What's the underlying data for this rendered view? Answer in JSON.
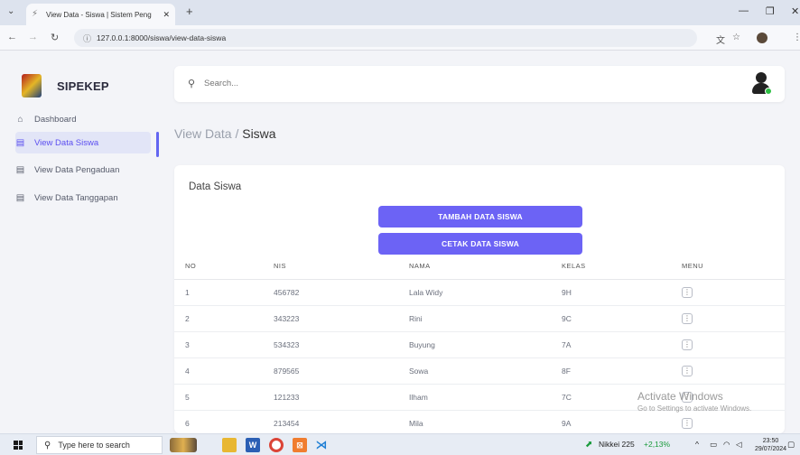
{
  "browser": {
    "tab_title": "View Data - Siswa | Sistem Peng",
    "url": "127.0.0.1:8000/siswa/view-data-siswa"
  },
  "app": {
    "brand": "SIPEKEP",
    "search_placeholder": "Search...",
    "sidebar": [
      {
        "label": "Dashboard",
        "icon": "home-icon"
      },
      {
        "label": "View Data Siswa",
        "icon": "archive-icon",
        "active": true
      },
      {
        "label": "View Data Pengaduan",
        "icon": "archive-icon"
      },
      {
        "label": "View Data Tanggapan",
        "icon": "archive-icon"
      }
    ],
    "breadcrumb": {
      "parent": "View Data / ",
      "current": "Siswa"
    },
    "card_title": "Data Siswa",
    "buttons": {
      "add": "TAMBAH DATA SISWA",
      "print": "CETAK DATA SISWA"
    },
    "table": {
      "headers": [
        "NO",
        "NIS",
        "NAMA",
        "KELAS",
        "MENU"
      ],
      "rows": [
        [
          "1",
          "456782",
          "Lala Widy",
          "9H"
        ],
        [
          "2",
          "343223",
          "Rini",
          "9C"
        ],
        [
          "3",
          "534323",
          "Buyung",
          "7A"
        ],
        [
          "4",
          "879565",
          "Sowa",
          "8F"
        ],
        [
          "5",
          "121233",
          "Ilham",
          "7C"
        ],
        [
          "6",
          "213454",
          "Mila",
          "9A"
        ]
      ]
    }
  },
  "watermark": {
    "line1": "Activate Windows",
    "line2": "Go to Settings to activate Windows."
  },
  "taskbar": {
    "search_placeholder": "Type here to search",
    "ticker_name": "Nikkei 225",
    "ticker_change": "+2,13%",
    "time": "23:50",
    "date": "29/07/2024"
  },
  "colors": {
    "accent": "#6c63f5",
    "active_text": "#5b4ef0",
    "positive": "#1a9b3c"
  }
}
